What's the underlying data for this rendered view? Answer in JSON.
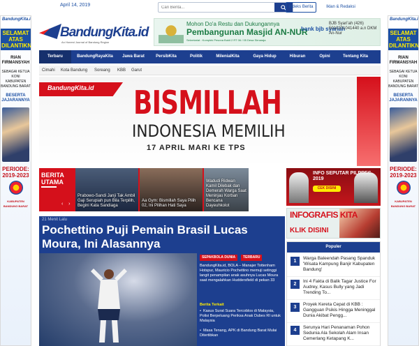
{
  "topbar": {
    "date": "April 14, 2019",
    "search_placeholder": "Cari Berita...",
    "search_icon": "search-icon",
    "index_label": "Indeks Berita",
    "iklan_label": "Iklan & Redaksi"
  },
  "logo": {
    "text": "BandungKita.id",
    "tagline": "An Honest Journal of Bandung Region"
  },
  "left_ad": {
    "brand": "BandungKita.id",
    "headline": "SELAMAT ATAS DILANTIKNYA",
    "name": "RIAN FIRMANSYAH",
    "role": "SEBAGAI KETUA KONI KABUPATEN BANDUNG BARAT",
    "extra": "BESERTA JAJARANNYA",
    "periode": "PERIODE: 2019-2023",
    "org": "KABUPATEN BANDUNG BARAT"
  },
  "right_ad": {
    "brand": "BandungKita.id",
    "headline": "SELAMAT ATAS DILANTIKNYA",
    "name": "RIAN FIRMANSYAH",
    "role": "SEBAGAI KETUA KONI KABUPATEN BANDUNG BARAT",
    "extra": "BESERTA JAJARANNYA",
    "periode": "PERIODE: 2019-2023",
    "org": "KABUPATEN BANDUNG BARAT"
  },
  "header_ad": {
    "line1": "Mohon Do'a Restu dan Dukungannya",
    "line2": "Pembangunan Masjid AN-NUR",
    "line3": "Sekretariat : Komplek Pesona Bukit 2 RT 06 / 05 Desa Sirnaraja",
    "bank": "bank bjb syariah",
    "account": "BJB Syari'ah (426) 5010201041440 a.n DKM An-Nur"
  },
  "nav": {
    "items": [
      "Terbaru",
      "BandungRayaKita",
      "Jawa Barat",
      "PersibKita",
      "Politik",
      "MilenialKita",
      "Gaya Hidup",
      "Hiburan",
      "Opini",
      "Tentang Kita"
    ],
    "active": "Terbaru"
  },
  "subnav": {
    "items": [
      "Cimahi",
      "Kota Bandung",
      "Soreang",
      "KBB",
      "Garut"
    ]
  },
  "hero": {
    "logo": "BandungKita.id",
    "h1": "BISMILLAH",
    "h2": "INDONESIA MEMILIH",
    "h3": "17 APRIL MARI KE TPS"
  },
  "berita_utama": {
    "label_line1": "BERITA",
    "label_line2": "UTAMA",
    "prev": "‹",
    "next": "›",
    "cards": [
      {
        "caption": "Prabowo-Sandi Janji Tak Ambil Gaji Serupiah pun Bila Terpilih, Begini Kata Sandiaga"
      },
      {
        "caption": "Aa Gym: Bismillah Saya Pilih 02, Ini Pilihan Hati Saya"
      },
      {
        "caption": "Wadudi Ridwan Kamil Dilebak dan Demerah Warga Saat Meninjau Korban Bencana Dayeuhkolot"
      }
    ]
  },
  "ad_pilpres": {
    "title": "INFO SEPUTAR PILPRES 2019",
    "button": "CEK DISINI"
  },
  "ad_infografis": {
    "title": "INFOGRAFIS KITA",
    "cta": "KLIK DISINI"
  },
  "article": {
    "meta": "21 Menit Lalu",
    "title": "Pochettino Puji Pemain Brasil Lucas Moura, Ini Alasannya",
    "tags": [
      "SEPAKBOLA DUNIA",
      "TERBARU"
    ],
    "body": "BandungKita.id, BOLA – Manajer Tottenham Hotspur, Mauricio Pochettino memuji setinggi langit penampilan anak asuhnya Lucas Moura saat mengalahkan Huddersfield di pekan 33",
    "related_heading": "Berita Terkait",
    "related": [
      "Kasus Surat Suara Tercoblos di Malaysia, Polisi Berpeluang Periksa Anak Dubes RI untuk Malaysia",
      "Masa Tenang, APK di Bandung Barat Mulai Ditertibkan"
    ]
  },
  "populer": {
    "heading": "Populer",
    "items": [
      {
        "num": "1",
        "text": "Warga Baleendah Pasang Spanduk 'Wisata Kampung Banjir Kabupaten Bandung'"
      },
      {
        "num": "2",
        "text": "Ini 4 Fakta di Balik Tagar Justice For Audrey, Kasus Bully yang Jadi Trending To..."
      },
      {
        "num": "3",
        "text": "Proyek Kereta Cepat di KBB : Gangguan Psikis Hingga Meninggal Dunia Akibat Pengg..."
      },
      {
        "num": "4",
        "text": "Serunya Hari Penanaman Pohon Sedunia Ala Sekolah Alam Insan Cemerlang Ketapang K..."
      }
    ]
  },
  "colors": {
    "brand_blue": "#1d3f8f",
    "brand_red": "#d5101b",
    "accent_yellow": "#ffec00"
  }
}
